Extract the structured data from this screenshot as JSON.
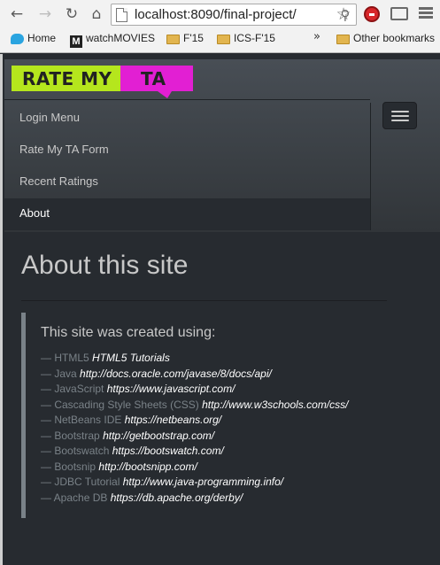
{
  "browser": {
    "url": "localhost:8090/final-project/",
    "bookmarks": [
      {
        "label": "Home",
        "icon": "twitter-icon"
      },
      {
        "label": "watchMOVIES",
        "icon": "movies-icon",
        "icon_glyph": "M"
      },
      {
        "label": "F'15",
        "icon": "folder-icon"
      },
      {
        "label": "ICS-F'15",
        "icon": "folder-icon"
      }
    ],
    "overflow_chevron": "»",
    "other_bookmarks": "Other bookmarks"
  },
  "navbar": {
    "brand_left": "RATE MY",
    "brand_right": "TA",
    "items": [
      {
        "label": "Login Menu",
        "active": false
      },
      {
        "label": "Rate My TA Form",
        "active": false
      },
      {
        "label": "Recent Ratings",
        "active": false
      },
      {
        "label": "About",
        "active": true
      }
    ]
  },
  "main": {
    "title": "About this site",
    "lead": "This site was created using:",
    "dash": "—",
    "resources": [
      {
        "name": "HTML5",
        "link": "HTML5 Tutorials"
      },
      {
        "name": "Java",
        "link": "http://docs.oracle.com/javase/8/docs/api/"
      },
      {
        "name": "JavaScript",
        "link": "https://www.javascript.com/"
      },
      {
        "name": "Cascading Style Sheets (CSS)",
        "link": "http://www.w3schools.com/css/"
      },
      {
        "name": "NetBeans IDE",
        "link": "https://netbeans.org/"
      },
      {
        "name": "Bootstrap",
        "link": "http://getbootstrap.com/"
      },
      {
        "name": "Bootswatch",
        "link": "https://bootswatch.com/"
      },
      {
        "name": "Bootsnip",
        "link": "http://bootsnipp.com/"
      },
      {
        "name": "JDBC Tutorial",
        "link": "http://www.java-programming.info/"
      },
      {
        "name": "Apache DB",
        "link": "https://db.apache.org/derby/"
      }
    ]
  },
  "colors": {
    "page_bg": "#272b30",
    "brand_green": "#b5e61d",
    "brand_magenta": "#e21fd3",
    "text_muted": "#7a8288"
  }
}
